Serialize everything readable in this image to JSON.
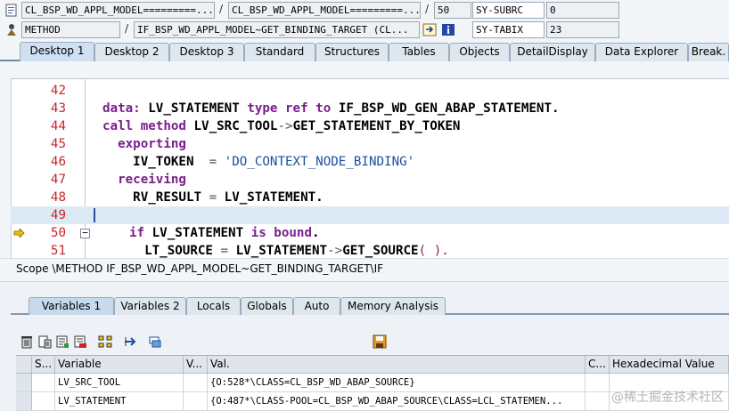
{
  "info": {
    "row1": {
      "program": "CL_BSP_WD_APPL_MODEL=========...",
      "include": "CL_BSP_WD_APPL_MODEL=========...",
      "line": "50",
      "sysfield": "SY-SUBRC",
      "sysvalue": "0"
    },
    "row2": {
      "event_type": "METHOD",
      "event": "IF_BSP_WD_APPL_MODEL~GET_BINDING_TARGET (CL...",
      "sysfield": "SY-TABIX",
      "sysvalue": "23"
    },
    "separator": "/"
  },
  "desktop_tabs": [
    "Desktop 1",
    "Desktop 2",
    "Desktop 3",
    "Standard",
    "Structures",
    "Tables",
    "Objects",
    "DetailDisplay",
    "Data Explorer",
    "Break."
  ],
  "code": {
    "lines": [
      {
        "num": "42",
        "tokens": []
      },
      {
        "num": "43",
        "tokens": [
          {
            "t": "data:",
            "c": "kw"
          },
          {
            "t": " LV_STATEMENT ",
            "c": ""
          },
          {
            "t": "type ref to",
            "c": "kw"
          },
          {
            "t": " IF_BSP_WD_GEN_ABAP_STATEMENT.",
            "c": ""
          }
        ]
      },
      {
        "num": "44",
        "tokens": [
          {
            "t": "call method",
            "c": "kw"
          },
          {
            "t": " LV_SRC_TOOL",
            "c": ""
          },
          {
            "t": "->",
            "c": "op"
          },
          {
            "t": "GET_STATEMENT_BY_TOKEN",
            "c": ""
          }
        ]
      },
      {
        "num": "45",
        "tokens": [
          {
            "t": "  exporting",
            "c": "kw"
          }
        ]
      },
      {
        "num": "46",
        "tokens": [
          {
            "t": "    IV_TOKEN  ",
            "c": ""
          },
          {
            "t": "=",
            "c": "op"
          },
          {
            "t": " 'DO_CONTEXT_NODE_BINDING'",
            "c": "str"
          }
        ]
      },
      {
        "num": "47",
        "tokens": [
          {
            "t": "  receiving",
            "c": "kw"
          }
        ]
      },
      {
        "num": "48",
        "tokens": [
          {
            "t": "    RV_RESULT ",
            "c": ""
          },
          {
            "t": "=",
            "c": "op"
          },
          {
            "t": " LV_STATEMENT.",
            "c": ""
          }
        ]
      },
      {
        "num": "49",
        "tokens": []
      },
      {
        "num": "50",
        "tokens": [
          {
            "t": "if",
            "c": "kw"
          },
          {
            "t": " LV_STATEMENT ",
            "c": ""
          },
          {
            "t": "is bound",
            "c": "kw"
          },
          {
            "t": ".",
            "c": ""
          }
        ]
      },
      {
        "num": "51",
        "tokens": [
          {
            "t": "  LT_SOURCE ",
            "c": ""
          },
          {
            "t": "=",
            "c": "op"
          },
          {
            "t": " LV_STATEMENT",
            "c": ""
          },
          {
            "t": "->",
            "c": "op"
          },
          {
            "t": "GET_SOURCE",
            "c": ""
          },
          {
            "t": "( ).",
            "c": "paren"
          }
        ]
      }
    ]
  },
  "scope": "Scope \\METHOD IF_BSP_WD_APPL_MODEL~GET_BINDING_TARGET\\IF",
  "variable_tabs": [
    "Variables 1",
    "Variables 2",
    "Locals",
    "Globals",
    "Auto",
    "Memory Analysis"
  ],
  "table": {
    "headers": [
      "S...",
      "Variable",
      "V...",
      "Val.",
      "C...",
      "Hexadecimal Value"
    ],
    "rows": [
      {
        "variable": "LV_SRC_TOOL",
        "value": "{O:528*\\CLASS=CL_BSP_WD_ABAP_SOURCE}"
      },
      {
        "variable": "LV_STATEMENT",
        "value": "{O:487*\\CLASS-POOL=CL_BSP_WD_ABAP_SOURCE\\CLASS=LCL_STATEMEN..."
      }
    ]
  },
  "watermark": "@稀土掘金技术社区",
  "colors": {
    "keyword": "#7a1f8e",
    "line_number": "#c8262a",
    "string": "#1a4f9c",
    "current_line": "#dde9f5"
  }
}
